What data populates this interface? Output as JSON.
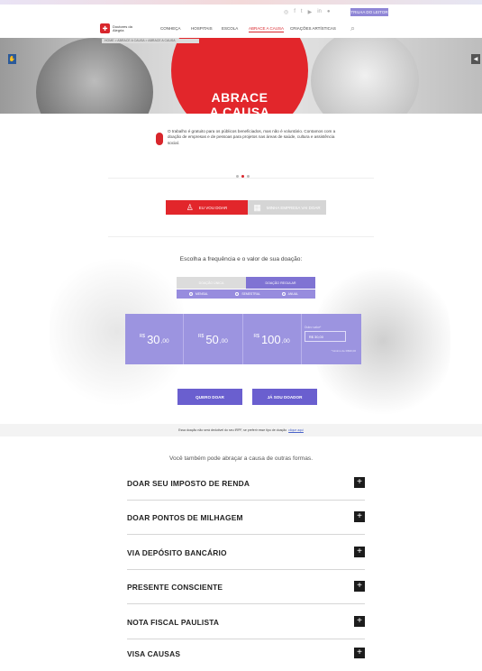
{
  "topbar": {
    "social_icons": [
      "instagram-icon",
      "facebook-icon",
      "twitter-icon",
      "youtube-icon",
      "linkedin-icon",
      "flickr-icon"
    ],
    "portal_button": "TRILHA DO LEITOR"
  },
  "nav": {
    "logo_text": "Doutores da Alegria",
    "items": [
      "CONHEÇA",
      "HOSPITAIS",
      "ESCOLA",
      "ABRACE A CAUSA",
      "CRIAÇÕES ARTÍSTICAS"
    ],
    "active_index": 3
  },
  "breadcrumb": "HOME > ABRACE A CAUSA > ABRACE A CAUSA",
  "hero": {
    "title_line1": "ABRACE",
    "title_line2": "A CAUSA"
  },
  "intro": {
    "text": "O trabalho é gratuito para os públicos beneficiados, mas não é voluntário. Contamos com a doação de empresas e de pessoas para projetos nas áreas de saúde, cultura e assistência social."
  },
  "tabs": {
    "donate": "EU VOU DOAR",
    "company": "MINHA EMPRESA VAI DOAR"
  },
  "donation": {
    "title": "Escolha a frequência e o valor de sua doação:",
    "freq_once": "DOAÇÃO ÚNICA",
    "freq_regular": "DOAÇÃO REGULAR",
    "periods": [
      "MENSAL",
      "SEMESTRAL",
      "ANUAL"
    ],
    "amounts": [
      {
        "currency": "R$",
        "value": "30",
        "cents": ",00"
      },
      {
        "currency": "R$",
        "value": "50",
        "cents": ",00"
      },
      {
        "currency": "R$",
        "value": "100",
        "cents": ",00"
      }
    ],
    "other_label": "Outro valor*",
    "other_placeholder": "R$ 30,00",
    "other_min": "*mínimo de R$30,00",
    "btn_donate": "QUERO DOAR",
    "btn_donor": "JÁ SOU DOADOR"
  },
  "tax_note": {
    "text": "Essa doação não será dedutível do seu IRPF, se preferir esse tipo de doação",
    "link": "clique aqui"
  },
  "other_forms": {
    "title": "Você também pode abraçar a causa de outras formas.",
    "items": [
      "DOAR SEU IMPOSTO DE RENDA",
      "DOAR PONTOS DE MILHAGEM",
      "VIA DEPÓSITO BANCÁRIO",
      "PRESENTE CONSCIENTE",
      "NOTA FISCAL PAULISTA",
      "VISA CAUSAS"
    ]
  },
  "colors": {
    "brand_red": "#e2262b",
    "purple": "#7f73d3",
    "purple_light": "#9c94e0"
  }
}
